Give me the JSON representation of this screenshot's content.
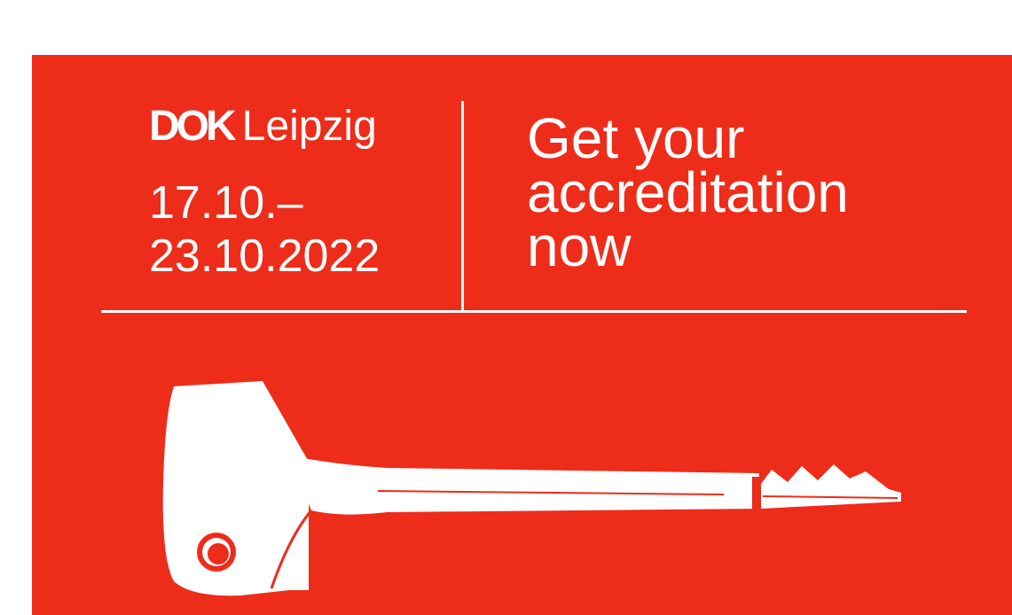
{
  "banner": {
    "background_color": "#ee2c1a",
    "logo": {
      "mark": "DOK",
      "city": "Leipzig"
    },
    "dates": {
      "line1": "17.10.–",
      "line2": "23.10.2022"
    },
    "headline": {
      "line1": "Get your",
      "line2": "accreditation",
      "line3": "now"
    },
    "illustration": "key-icon"
  }
}
